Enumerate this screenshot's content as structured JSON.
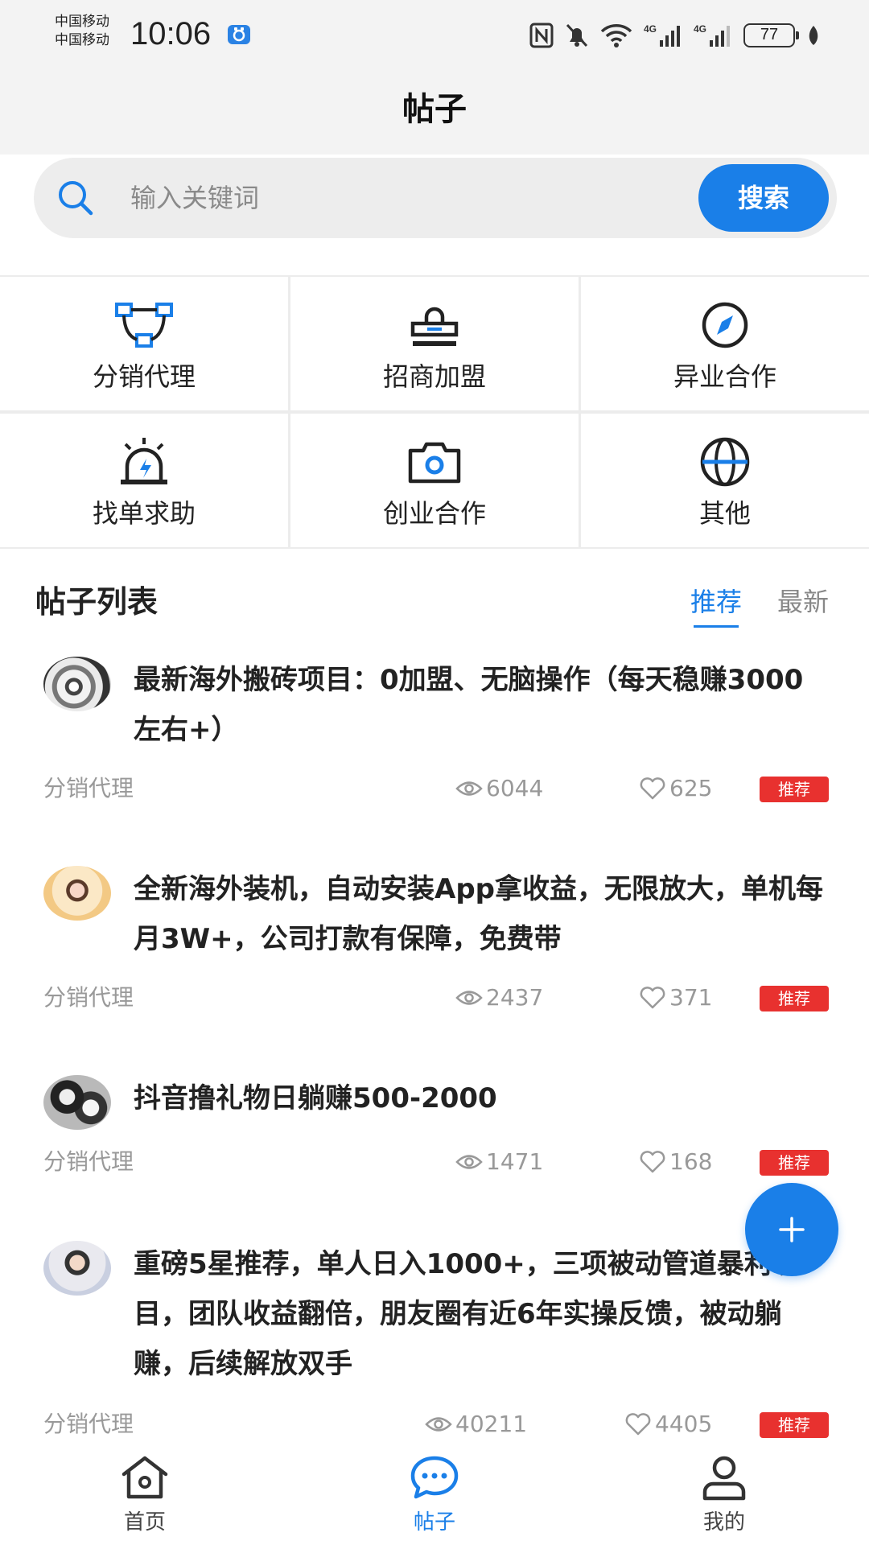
{
  "status_bar": {
    "carrier_1": "中国移动",
    "carrier_2": "中国移动",
    "time": "10:06",
    "battery": "77"
  },
  "header": {
    "title": "帖子"
  },
  "search": {
    "placeholder": "输入关键词",
    "button_label": "搜索"
  },
  "categories": [
    {
      "label": "分销代理",
      "icon": "distribution-network-icon"
    },
    {
      "label": "招商加盟",
      "icon": "stamp-icon"
    },
    {
      "label": "异业合作",
      "icon": "compass-icon"
    },
    {
      "label": "找单求助",
      "icon": "alarm-siren-icon"
    },
    {
      "label": "创业合作",
      "icon": "camera-icon"
    },
    {
      "label": "其他",
      "icon": "globe-icon"
    }
  ],
  "list": {
    "title": "帖子列表",
    "tabs": [
      {
        "label": "推荐",
        "active": true
      },
      {
        "label": "最新",
        "active": false
      }
    ]
  },
  "posts": [
    {
      "title": "最新海外搬砖项目：0加盟、无脑操作（每天稳赚3000左右+）",
      "category": "分销代理",
      "views": "6044",
      "likes": "625",
      "badge": "推荐"
    },
    {
      "title": "全新海外装机，自动安装App拿收益，无限放大，单机每月3W+，公司打款有保障，免费带",
      "category": "分销代理",
      "views": "2437",
      "likes": "371",
      "badge": "推荐"
    },
    {
      "title": "抖音撸礼物日躺赚500-2000",
      "category": "分销代理",
      "views": "1471",
      "likes": "168",
      "badge": "推荐"
    },
    {
      "title": "重磅5星推荐，单人日入1000+，三项被动管道暴利项目，团队收益翻倍，朋友圈有近6年实操反馈，被动躺赚，后续解放双手",
      "category": "分销代理",
      "views": "40211",
      "likes": "4405",
      "badge": "推荐"
    }
  ],
  "fab": {
    "icon": "plus-icon"
  },
  "bottom_nav": [
    {
      "label": "首页",
      "icon": "home-icon",
      "active": false
    },
    {
      "label": "帖子",
      "icon": "chat-bubble-icon",
      "active": true
    },
    {
      "label": "我的",
      "icon": "user-icon",
      "active": false
    }
  ],
  "colors": {
    "accent": "#1a7fe8",
    "badge": "#e8312f",
    "muted": "#999999"
  }
}
